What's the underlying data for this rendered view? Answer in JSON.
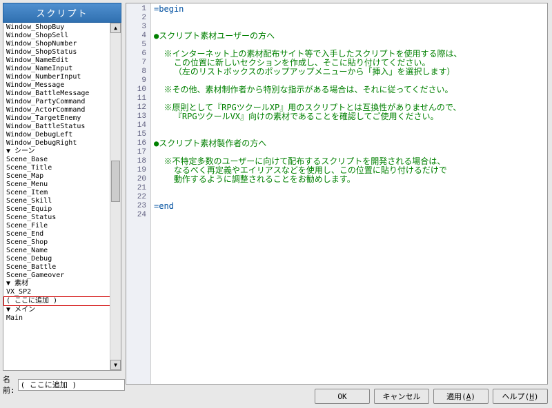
{
  "header": {
    "title": "スクリプト"
  },
  "scriptList": {
    "group1_items": [
      "Window_ShopBuy",
      "Window_ShopSell",
      "Window_ShopNumber",
      "Window_ShopStatus",
      "Window_NameEdit",
      "Window_NameInput",
      "Window_NumberInput",
      "Window_Message",
      "Window_BattleMessage",
      "Window_PartyCommand",
      "Window_ActorCommand",
      "Window_TargetEnemy",
      "Window_BattleStatus",
      "Window_DebugLeft",
      "Window_DebugRight"
    ],
    "group2_header": "▼ シーン",
    "group2_items": [
      "Scene_Base",
      "Scene_Title",
      "Scene_Map",
      "Scene_Menu",
      "Scene_Item",
      "Scene_Skill",
      "Scene_Equip",
      "Scene_Status",
      "Scene_File",
      "Scene_End",
      "Scene_Shop",
      "Scene_Name",
      "Scene_Debug",
      "Scene_Battle",
      "Scene_Gameover"
    ],
    "group3_header": "▼ 素材",
    "group3_items": [
      "VX_SP2"
    ],
    "selected_item": "( ここに追加 )",
    "group4_header": "▼ メイン",
    "group4_items": [
      "Main"
    ]
  },
  "nameRow": {
    "label": "名前:",
    "value": "( ここに追加 )"
  },
  "code": {
    "lines": [
      {
        "n": 1,
        "cls": "c-blue",
        "text": "=begin"
      },
      {
        "n": 2,
        "cls": "",
        "text": ""
      },
      {
        "n": 3,
        "cls": "",
        "text": ""
      },
      {
        "n": 4,
        "cls": "c-green",
        "text": "●スクリプト素材ユーザーの方へ"
      },
      {
        "n": 5,
        "cls": "",
        "text": ""
      },
      {
        "n": 6,
        "cls": "c-green",
        "text": "  ※インターネット上の素材配布サイト等で入手したスクリプトを使用する際は、"
      },
      {
        "n": 7,
        "cls": "c-green",
        "text": "    この位置に新しいセクションを作成し、そこに貼り付けてください。"
      },
      {
        "n": 8,
        "cls": "c-green",
        "text": "    （左のリストボックスのポップアップメニューから「挿入」を選択します）"
      },
      {
        "n": 9,
        "cls": "",
        "text": ""
      },
      {
        "n": 10,
        "cls": "c-green",
        "text": "  ※その他、素材制作者から特別な指示がある場合は、それに従ってください。"
      },
      {
        "n": 11,
        "cls": "",
        "text": ""
      },
      {
        "n": 12,
        "cls": "c-green",
        "text": "  ※原則として『RPGツクールXP』用のスクリプトとは互換性がありませんので、"
      },
      {
        "n": 13,
        "cls": "c-green",
        "text": "    『RPGツクールVX』向けの素材であることを確認してご使用ください。"
      },
      {
        "n": 14,
        "cls": "",
        "text": ""
      },
      {
        "n": 15,
        "cls": "",
        "text": ""
      },
      {
        "n": 16,
        "cls": "c-green",
        "text": "●スクリプト素材製作者の方へ"
      },
      {
        "n": 17,
        "cls": "",
        "text": ""
      },
      {
        "n": 18,
        "cls": "c-green",
        "text": "  ※不特定多数のユーザーに向けて配布するスクリプトを開発される場合は、"
      },
      {
        "n": 19,
        "cls": "c-green",
        "text": "    なるべく再定義やエイリアスなどを使用し、この位置に貼り付けるだけで"
      },
      {
        "n": 20,
        "cls": "c-green",
        "text": "    動作するように調整されることをお勧めします。"
      },
      {
        "n": 21,
        "cls": "",
        "text": ""
      },
      {
        "n": 22,
        "cls": "",
        "text": ""
      },
      {
        "n": 23,
        "cls": "c-blue",
        "text": "=end"
      },
      {
        "n": 24,
        "cls": "",
        "text": ""
      }
    ]
  },
  "buttons": {
    "ok": "OK",
    "cancel": "キャンセル",
    "apply": "適用",
    "apply_accel": "A",
    "help": "ヘルプ",
    "help_accel": "H"
  }
}
